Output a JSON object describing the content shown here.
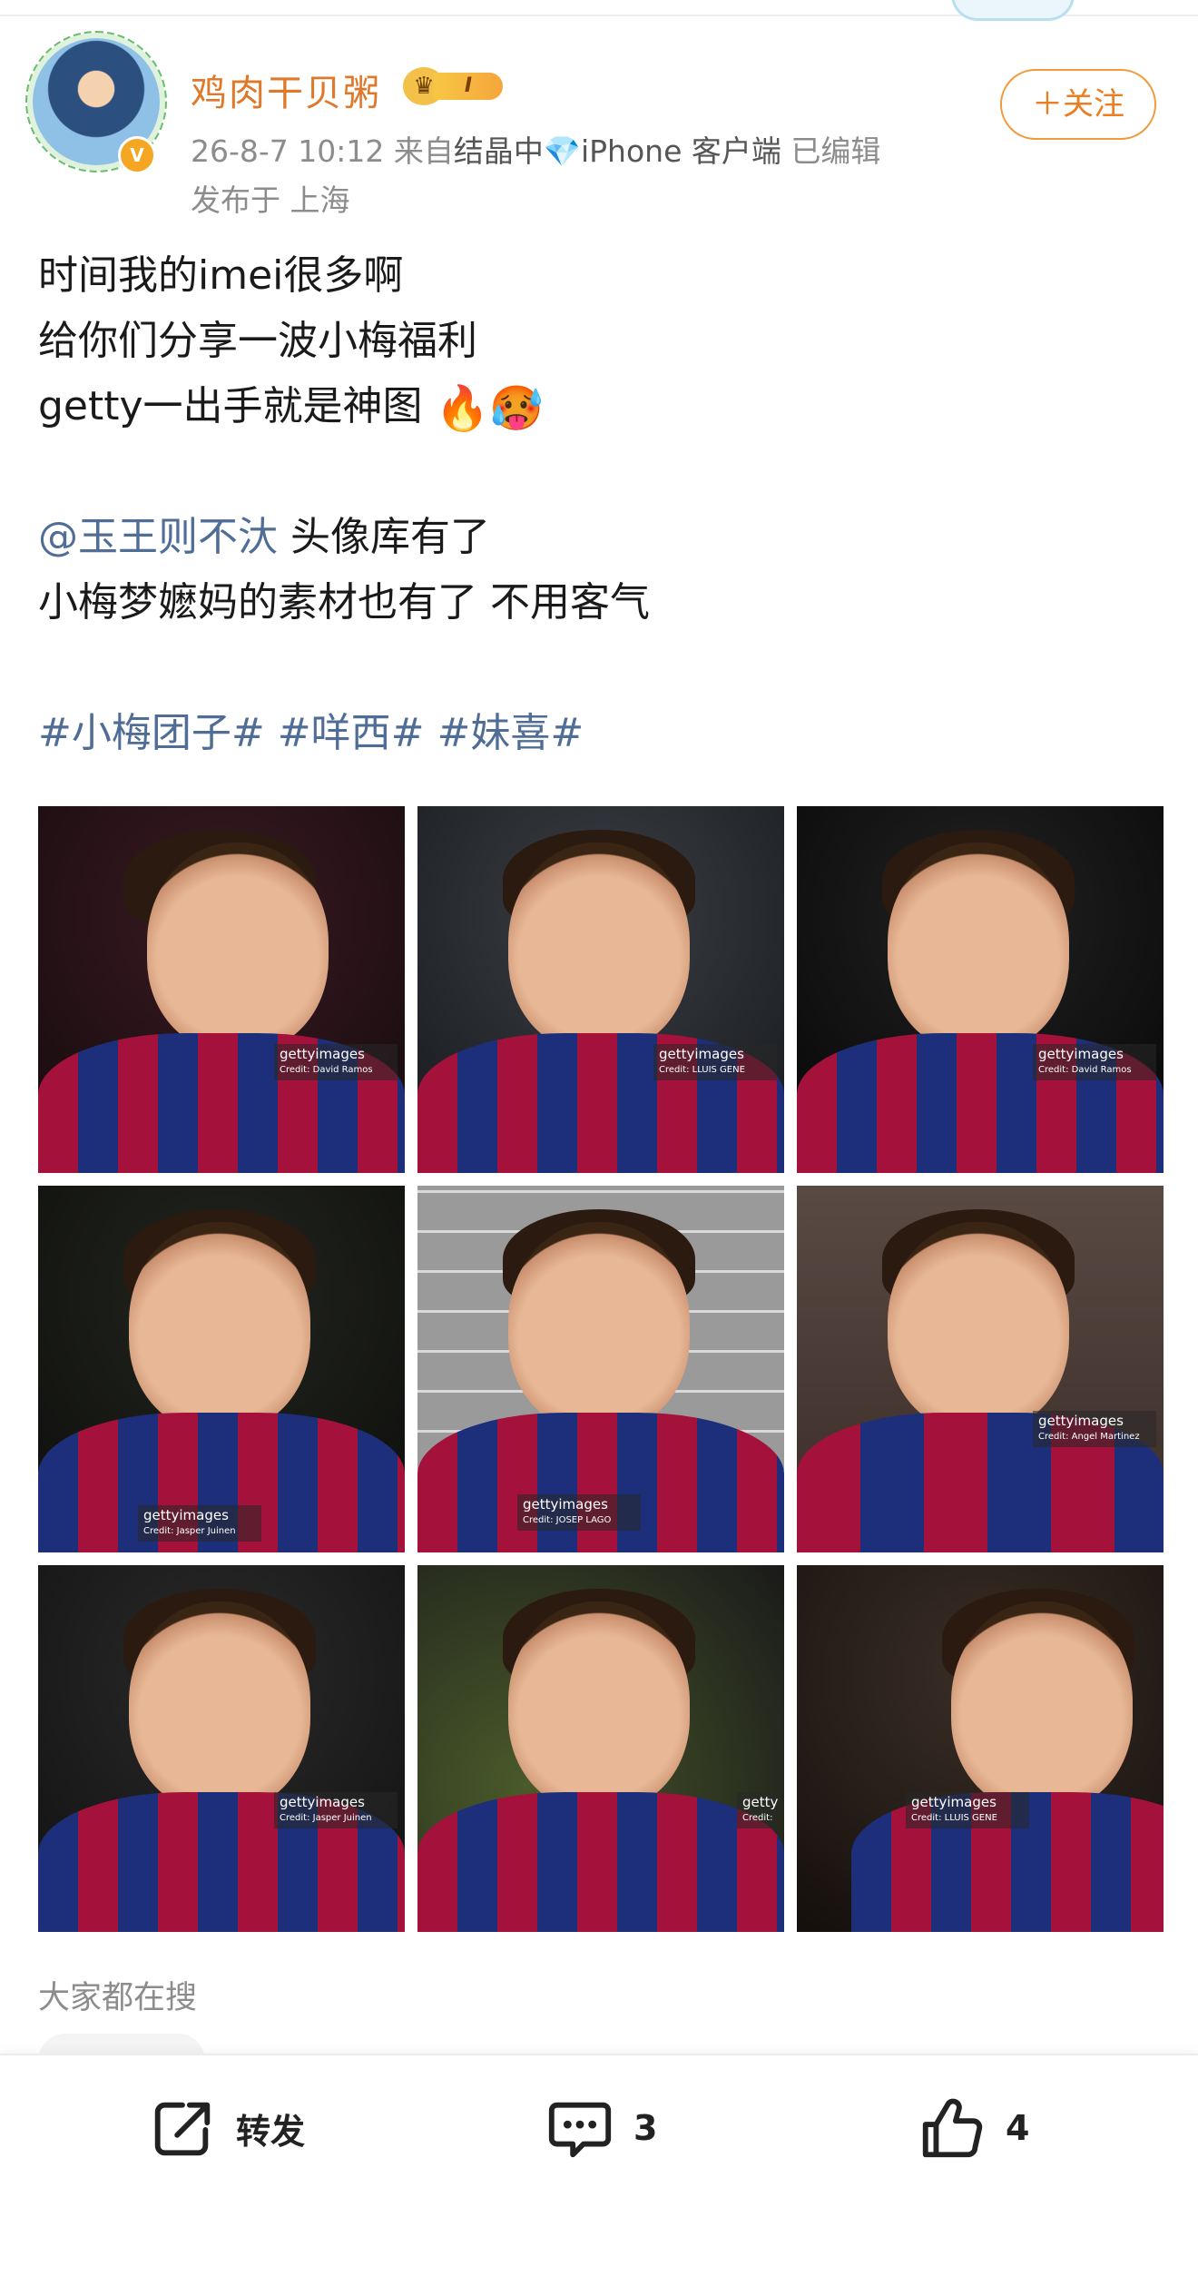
{
  "user": {
    "name": "鸡肉干贝粥",
    "vip_level": "I",
    "verified_mark": "V",
    "icons": {
      "avatar": "avatar-image",
      "vip": "crown-icon",
      "verified": "verified-icon"
    }
  },
  "post_meta": {
    "datetime": "26-8-7 10:12",
    "from_prefix": "来自",
    "source": "结晶中",
    "source_icon": "diamond-icon",
    "client": "iPhone 客户端",
    "edited": "已编辑",
    "location": "发布于 上海"
  },
  "follow_button": {
    "label": "＋关注"
  },
  "content": {
    "line1": "时间我的imei很多啊",
    "line2": "给你们分享一波小梅福利",
    "line3": "getty一出手就是神图",
    "emoji1": "🔥",
    "emoji2": "🥵",
    "mention": "@玉王则不汏",
    "mention_rest": " 头像库有了",
    "line5": "小梅梦嬷妈的素材也有了 不用客气",
    "tags": [
      "#小梅团子#",
      "#咩西#",
      "#妹喜#"
    ]
  },
  "photos": [
    {
      "wm": "gettyimages",
      "credit": "Credit: David Ramos"
    },
    {
      "wm": "gettyimages",
      "credit": "Credit: LLUIS GENE"
    },
    {
      "wm": "gettyimages",
      "credit": "Credit: David Ramos"
    },
    {
      "wm": "gettyimages",
      "credit": "Credit: Jasper Juinen"
    },
    {
      "wm": "gettyimages",
      "credit": "Credit: JOSEP LAGO"
    },
    {
      "wm": "gettyimages",
      "credit": "Credit: Angel Martinez"
    },
    {
      "wm": "gettyimages",
      "credit": "Credit: Jasper Juinen"
    },
    {
      "wm": "getty",
      "credit": "Credit:"
    },
    {
      "wm": "gettyimages",
      "credit": "Credit: LLUIS GENE"
    }
  ],
  "search_section": {
    "title": "大家都在搜"
  },
  "actions": {
    "repost": {
      "label": "转发",
      "icon": "repost-icon"
    },
    "comment": {
      "count": "3",
      "icon": "comment-icon"
    },
    "like": {
      "count": "4",
      "icon": "thumbs-up-icon"
    }
  },
  "colors": {
    "username": "#e0782a",
    "follow": "#ec7e22",
    "link": "#4f6d96",
    "meta": "#8c8c8c",
    "kit_red": "#a4113a",
    "kit_blue": "#1d2f7a"
  }
}
